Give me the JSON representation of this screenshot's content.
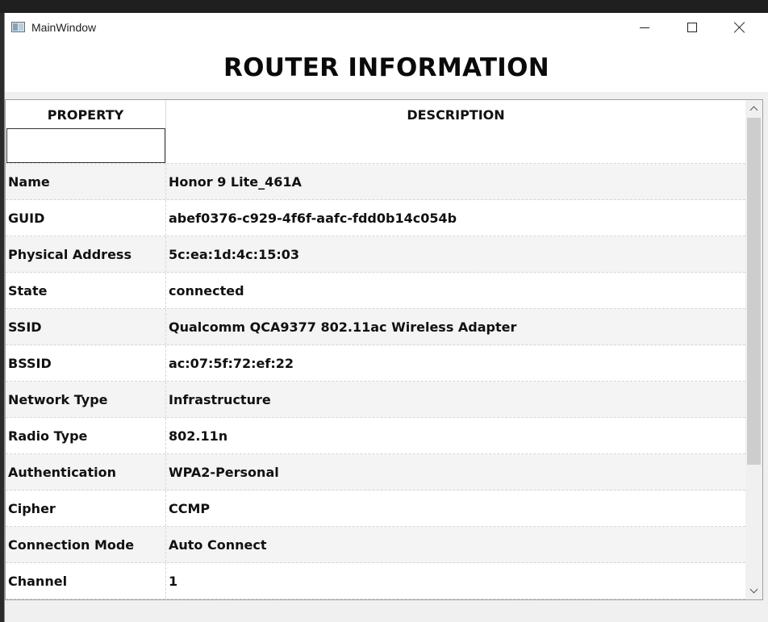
{
  "window": {
    "title": "MainWindow",
    "controls": {
      "minimize": "minimize",
      "maximize": "maximize",
      "close": "close"
    }
  },
  "header": {
    "heading": "ROUTER INFORMATION"
  },
  "table": {
    "columns": [
      "PROPERTY",
      "DESCRIPTION"
    ],
    "filter": {
      "value": "",
      "placeholder": ""
    },
    "rows": [
      {
        "property": "Name",
        "description": "Honor 9 Lite_461A"
      },
      {
        "property": "GUID",
        "description": "abef0376-c929-4f6f-aafc-fdd0b14c054b"
      },
      {
        "property": "Physical Address",
        "description": "5c:ea:1d:4c:15:03"
      },
      {
        "property": "State",
        "description": "connected"
      },
      {
        "property": "SSID",
        "description": "Qualcomm QCA9377 802.11ac Wireless Adapter"
      },
      {
        "property": "BSSID",
        "description": "ac:07:5f:72:ef:22"
      },
      {
        "property": "Network Type",
        "description": "Infrastructure"
      },
      {
        "property": "Radio Type",
        "description": "802.11n"
      },
      {
        "property": "Authentication",
        "description": "WPA2-Personal"
      },
      {
        "property": "Cipher",
        "description": "CCMP"
      },
      {
        "property": "Connection Mode",
        "description": "Auto Connect"
      },
      {
        "property": "Channel",
        "description": "1"
      }
    ]
  },
  "icons": {
    "app": "window-app-icon",
    "minimize": "minimize-icon",
    "maximize": "maximize-icon",
    "close": "close-icon",
    "scroll_up": "chevron-up-icon",
    "scroll_down": "chevron-down-icon"
  },
  "colors": {
    "row_alt": "#f4f4f4",
    "row": "#ffffff",
    "window_bg": "#f0f0f0",
    "scroll_thumb": "#cdcdcd"
  }
}
